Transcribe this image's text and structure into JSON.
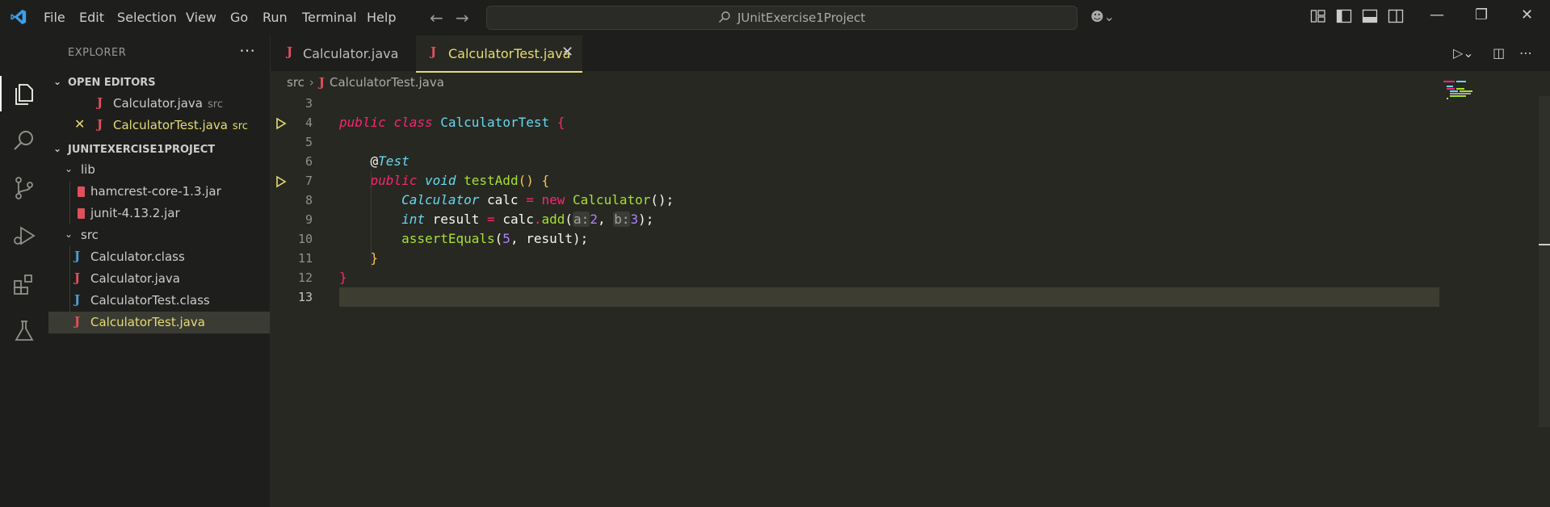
{
  "menu": [
    "File",
    "Edit",
    "Selection",
    "View",
    "Go",
    "Run",
    "Terminal",
    "Help"
  ],
  "search": {
    "text": "JUnitExercise1Project"
  },
  "sidebar": {
    "title": "EXPLORER",
    "open_editors": {
      "header": "OPEN EDITORS",
      "items": [
        {
          "name": "Calculator.java",
          "desc": "src"
        },
        {
          "name": "CalculatorTest.java",
          "desc": "src"
        }
      ]
    },
    "project": {
      "header": "JUNITEXERCISE1PROJECT",
      "lib": {
        "name": "lib",
        "files": [
          "hamcrest-core-1.3.jar",
          "junit-4.13.2.jar"
        ]
      },
      "src": {
        "name": "src",
        "files": [
          "Calculator.class",
          "Calculator.java",
          "CalculatorTest.class",
          "CalculatorTest.java"
        ]
      }
    }
  },
  "tabs": [
    {
      "label": "Calculator.java"
    },
    {
      "label": "CalculatorTest.java"
    }
  ],
  "breadcrumb": {
    "folder": "src",
    "file": "CalculatorTest.java"
  },
  "code": {
    "line_numbers": [
      "3",
      "4",
      "5",
      "6",
      "7",
      "8",
      "9",
      "10",
      "11",
      "12",
      "13"
    ]
  },
  "colors": {
    "accent_tab": "#e6db74",
    "keyword": "#f92672",
    "type": "#66d9ef",
    "function": "#a6e22e",
    "number": "#ae81ff",
    "background": "#272822"
  },
  "icons": [
    "vscode-logo-icon",
    "files-icon",
    "search-icon",
    "source-control-icon",
    "run-debug-icon",
    "extensions-icon",
    "testing-icon",
    "copilot-icon",
    "run-test-icon"
  ]
}
